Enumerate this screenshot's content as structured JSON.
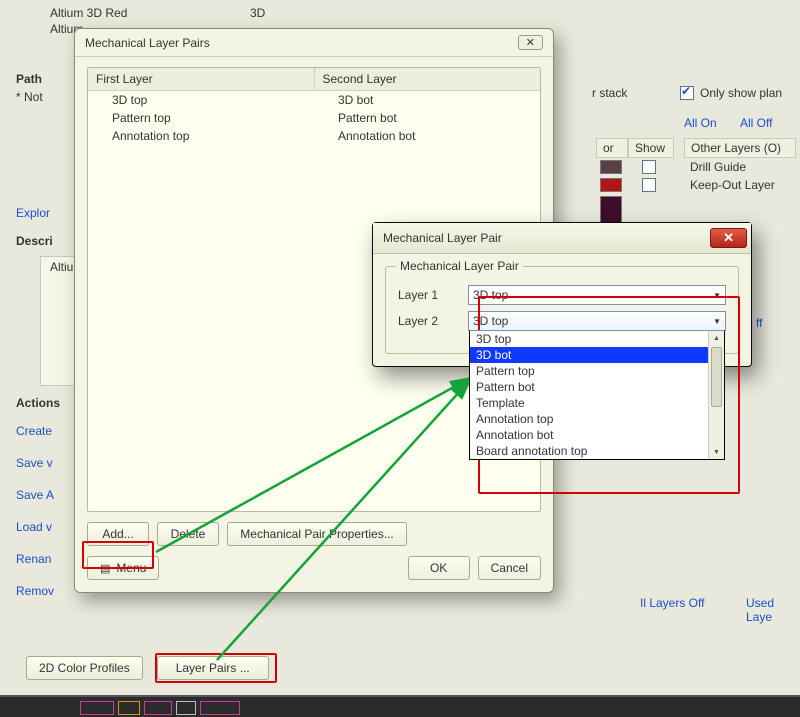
{
  "bg": {
    "row_names": [
      "Altium 3D Red",
      "Altium"
    ],
    "row_kind": "3D",
    "path_label": "Path",
    "path_note": "* Not",
    "explore": "Explor",
    "descri": "Descri",
    "altiu": "Altiu",
    "actions_label": "Actions",
    "links": {
      "create": "Create",
      "savev": "Save v",
      "savea": "Save A",
      "loadv": "Load v",
      "renan": "Renan",
      "remov": "Remov",
      "all_on": "All On",
      "all_off": "All Off",
      "il_layers_off": "Il Layers Off",
      "used_laye": "Used Laye",
      "ff": "ff"
    },
    "only_show": "Only show plan",
    "stack": "r stack",
    "headers": {
      "or": "or",
      "show": "Show",
      "other": "Other Layers (O)"
    },
    "other_layers": [
      "Drill Guide",
      "Keep-Out Layer"
    ],
    "swatches": [
      "#574047",
      "#b31414"
    ]
  },
  "dlg1": {
    "title": "Mechanical Layer Pairs",
    "cols": [
      "First Layer",
      "Second Layer"
    ],
    "rows": [
      {
        "a": "3D top",
        "b": "3D bot"
      },
      {
        "a": "Pattern top",
        "b": "Pattern bot"
      },
      {
        "a": "Annotation top",
        "b": "Annotation bot"
      }
    ],
    "btns": {
      "add": "Add...",
      "delete": "Delete",
      "props": "Mechanical Pair Properties...",
      "menu": "Menu",
      "ok": "OK",
      "cancel": "Cancel"
    }
  },
  "dlg2": {
    "title": "Mechanical Layer Pair",
    "group": "Mechanical Layer Pair",
    "layer1": "Layer 1",
    "layer2": "Layer 2",
    "combo1_value": "3D top",
    "combo2_value": "3D top",
    "options": [
      "3D top",
      "3D bot",
      "Pattern top",
      "Pattern bot",
      "Template",
      "Annotation top",
      "Annotation bot",
      "Board annotation top"
    ],
    "selected_index": 1
  },
  "bottom": {
    "profiles": "2D Color Profiles",
    "pairs": "Layer Pairs ..."
  }
}
